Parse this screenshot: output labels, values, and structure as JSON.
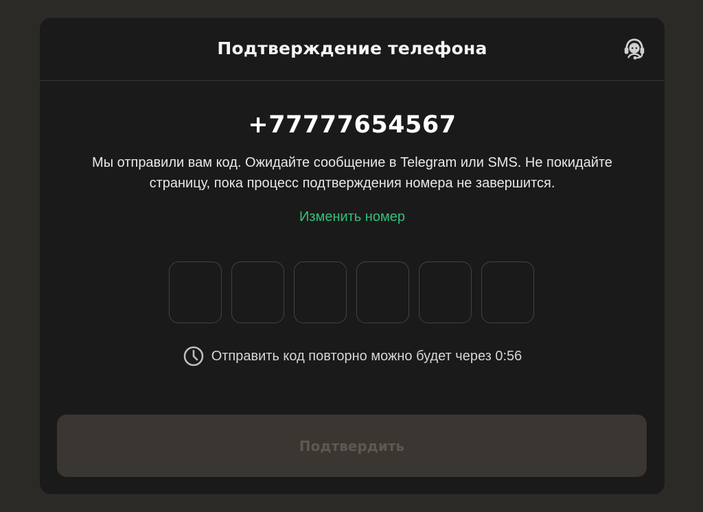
{
  "header": {
    "title": "Подтверждение телефона",
    "support_icon": "headset-icon"
  },
  "phone": {
    "number": "+77777654567"
  },
  "description": {
    "text": "Мы отправили вам код. Ожидайте сообщение в Telegram или SMS. Не покидайте страницу, пока процесс подтверждения номера не завершится."
  },
  "change_number": {
    "label": "Изменить номер"
  },
  "code": {
    "digits": [
      "",
      "",
      "",
      "",
      "",
      ""
    ]
  },
  "resend": {
    "icon": "clock-icon",
    "text": "Отправить код повторно можно будет через 0:56"
  },
  "confirm": {
    "label": "Подтвердить",
    "disabled": true
  },
  "colors": {
    "background": "#2c2a26",
    "modal": "#1b1a1a",
    "accent": "#2fc27a",
    "button_disabled_bg": "#3a3631",
    "button_disabled_text": "#5d5852"
  }
}
